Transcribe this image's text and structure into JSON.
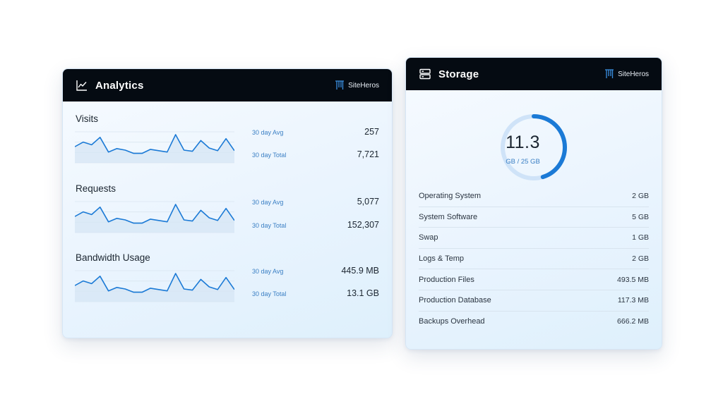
{
  "analytics": {
    "title": "Analytics",
    "brand": "SiteHeros",
    "metrics": [
      {
        "title": "Visits",
        "avg_label": "30 day Avg",
        "avg_value": "257",
        "total_label": "30 day Total",
        "total_value": "7,721",
        "trend": [
          0.55,
          0.72,
          0.62,
          0.9,
          0.35,
          0.48,
          0.42,
          0.3,
          0.3,
          0.45,
          0.4,
          0.35,
          1.0,
          0.42,
          0.38,
          0.78,
          0.5,
          0.4,
          0.85,
          0.4
        ]
      },
      {
        "title": "Requests",
        "avg_label": "30 day Avg",
        "avg_value": "5,077",
        "total_label": "30 day Total",
        "total_value": "152,307",
        "trend": [
          0.55,
          0.72,
          0.62,
          0.9,
          0.35,
          0.48,
          0.42,
          0.3,
          0.3,
          0.45,
          0.4,
          0.35,
          1.0,
          0.42,
          0.38,
          0.78,
          0.5,
          0.4,
          0.85,
          0.4
        ]
      },
      {
        "title": "Bandwidth Usage",
        "avg_label": "30 day Avg",
        "avg_value": "445.9 MB",
        "total_label": "30 day Total",
        "total_value": "13.1 GB",
        "trend": [
          0.55,
          0.72,
          0.62,
          0.9,
          0.35,
          0.48,
          0.42,
          0.3,
          0.3,
          0.45,
          0.4,
          0.35,
          1.0,
          0.42,
          0.38,
          0.78,
          0.5,
          0.4,
          0.85,
          0.4
        ]
      }
    ]
  },
  "storage": {
    "title": "Storage",
    "brand": "SiteHeros",
    "used": "11.3",
    "used_fraction": 0.452,
    "capacity_text": "GB / 25 GB",
    "rows": [
      {
        "label": "Operating System",
        "value": "2 GB"
      },
      {
        "label": "System Software",
        "value": "5 GB"
      },
      {
        "label": "Swap",
        "value": "1 GB"
      },
      {
        "label": "Logs & Temp",
        "value": "2 GB"
      },
      {
        "label": "Production Files",
        "value": "493.5 MB"
      },
      {
        "label": "Production Database",
        "value": "117.3 MB"
      },
      {
        "label": "Backups Overhead",
        "value": "666.2 MB"
      }
    ]
  },
  "colors": {
    "header_bg": "#050b12",
    "accent": "#1b7ad6",
    "accent_light": "#cfe3f8",
    "spark_fill": "#d6e6f4"
  },
  "icons": {
    "analytics": "line-chart-icon",
    "storage": "server-stack-icon",
    "brand": "siteheros-logo-icon"
  }
}
